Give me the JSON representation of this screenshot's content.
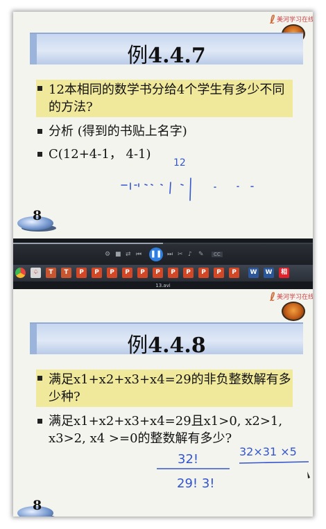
{
  "slides": [
    {
      "title_prefix": "例",
      "title_number": "4.4.7",
      "logo_text": "美河学习在线",
      "bullets": [
        "12本相同的数学书分给4个学生有多少不同的方法?",
        "分析 (得到的书贴上名字)",
        "C(12+4-1， 4-1)"
      ],
      "page_number": "8",
      "handwriting": {
        "label": "12"
      }
    },
    {
      "title_prefix": "例",
      "title_number": "4.4.8",
      "logo_text": "美河学习在线",
      "bullets": [
        "满足x1+x2+x3+x4=29的非负整数解有多少种?",
        "满足x1+x2+x3+x4=29且x1>0, x2>1, x3>2, x4 >=0的整数解有多少?"
      ],
      "page_number": "8",
      "handwriting": {
        "numerator": "32!",
        "denominator": "29! 3!",
        "product": "32×31 ×5"
      }
    }
  ],
  "player": {
    "file_name": "13.avi",
    "play_icon": "pause-icon",
    "progress": 0.5
  },
  "taskbar": {
    "icons": [
      {
        "name": "chrome-icon",
        "color": "#e8453c",
        "label": ""
      },
      {
        "name": "pdf-icon",
        "color": "#d9d9d9",
        "label": "♤"
      },
      {
        "name": "text-icon",
        "color": "#c7552f",
        "label": "T"
      },
      {
        "name": "text-icon-2",
        "color": "#c7552f",
        "label": "T"
      },
      {
        "name": "ppt-icon",
        "color": "#d24726",
        "label": "P"
      },
      {
        "name": "ppt-icon-2",
        "color": "#d24726",
        "label": "P"
      },
      {
        "name": "ppt-icon-3",
        "color": "#d24726",
        "label": "P"
      },
      {
        "name": "ppt-icon-4",
        "color": "#d24726",
        "label": "P"
      },
      {
        "name": "ppt-icon-5",
        "color": "#d24726",
        "label": "P"
      },
      {
        "name": "ppt-icon-6",
        "color": "#d24726",
        "label": "P"
      },
      {
        "name": "ppt-icon-7",
        "color": "#d24726",
        "label": "P"
      },
      {
        "name": "ppt-icon-8",
        "color": "#d24726",
        "label": "P"
      },
      {
        "name": "ppt-icon-9",
        "color": "#d24726",
        "label": "P"
      },
      {
        "name": "ppt-icon-10",
        "color": "#d24726",
        "label": "P"
      },
      {
        "name": "ppt-icon-11",
        "color": "#d24726",
        "label": "P"
      },
      {
        "name": "word-icon",
        "color": "#2b579a",
        "label": "W"
      },
      {
        "name": "word-icon-2",
        "color": "#2b579a",
        "label": "W"
      },
      {
        "name": "app-icon",
        "color": "#e0202a",
        "label": "相"
      }
    ]
  },
  "colors": {
    "highlight": "#f0e89a",
    "title_bar": "#c8d8f0",
    "ink": "#3355cc",
    "play": "#2f7fe0"
  }
}
